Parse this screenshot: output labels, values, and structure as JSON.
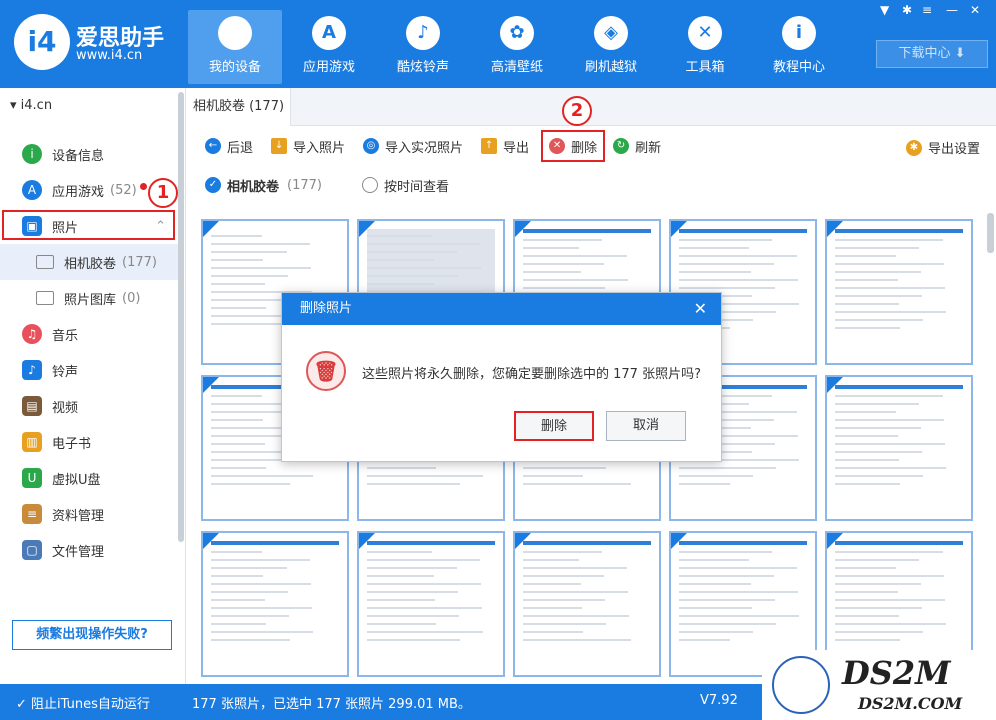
{
  "brand": {
    "logo": "i4",
    "name": "爱思助手",
    "url": "www.i4.cn"
  },
  "nav": [
    {
      "label": "我的设备",
      "icon": "apple-icon",
      "glyph": ""
    },
    {
      "label": "应用游戏",
      "icon": "app-store-icon",
      "glyph": "A"
    },
    {
      "label": "酷炫铃声",
      "icon": "bell-icon",
      "glyph": "♪"
    },
    {
      "label": "高清壁纸",
      "icon": "flower-icon",
      "glyph": "✿"
    },
    {
      "label": "刷机越狱",
      "icon": "dropbox-icon",
      "glyph": "◈"
    },
    {
      "label": "工具箱",
      "icon": "tools-icon",
      "glyph": "✕"
    },
    {
      "label": "教程中心",
      "icon": "info-icon",
      "glyph": "i"
    }
  ],
  "window": {
    "download_center": "下载中心 ⬇"
  },
  "sidebar": {
    "device": "i4.cn",
    "items": [
      {
        "label": "设备信息",
        "icon": "info-icon",
        "color": "#2aa84a",
        "glyph": "i"
      },
      {
        "label": "应用游戏",
        "count": "(52)",
        "icon": "app-icon",
        "color": "#1a7be0",
        "glyph": "A"
      },
      {
        "label": "照片",
        "icon": "photo-icon",
        "color": "#1a7be0",
        "glyph": "▣"
      },
      {
        "label": "相机胶卷",
        "count": "(177)",
        "icon": "folder-icon"
      },
      {
        "label": "照片图库",
        "count": "(0)",
        "icon": "folder-icon"
      },
      {
        "label": "音乐",
        "icon": "music-icon",
        "color": "#e8505b",
        "glyph": "♫"
      },
      {
        "label": "铃声",
        "icon": "bell-icon",
        "color": "#1a7be0",
        "glyph": "♪"
      },
      {
        "label": "视频",
        "icon": "video-icon",
        "color": "#7a5a3a",
        "glyph": "▤"
      },
      {
        "label": "电子书",
        "icon": "book-icon",
        "color": "#e8a020",
        "glyph": "▥"
      },
      {
        "label": "虚拟U盘",
        "icon": "usb-icon",
        "color": "#2aa84a",
        "glyph": "U"
      },
      {
        "label": "资料管理",
        "icon": "contacts-icon",
        "color": "#c98a3a",
        "glyph": "≡"
      },
      {
        "label": "文件管理",
        "icon": "file-icon",
        "color": "#4a7ab8",
        "glyph": "▢"
      }
    ],
    "footer": "频繁出现操作失败?"
  },
  "annotations": {
    "step1": "1",
    "step2": "2"
  },
  "content": {
    "tab": "相机胶卷 (177)",
    "toolbar": {
      "back": "后退",
      "import_photos": "导入照片",
      "import_live": "导入实况照片",
      "export": "导出",
      "delete": "删除",
      "refresh": "刷新",
      "export_settings": "导出设置"
    },
    "filter": {
      "album": "相机胶卷",
      "album_count": "(177)",
      "by_time": "按时间查看"
    }
  },
  "dialog": {
    "title": "删除照片",
    "message": "这些照片将永久删除，您确定要删除选中的 177 张照片吗?",
    "confirm": "删除",
    "cancel": "取消"
  },
  "status": {
    "itunes": "阻止iTunes自动运行",
    "summary": "177 张照片，已选中 177 张照片 299.01 MB。",
    "version": "V7.92"
  },
  "watermark": {
    "name": "DS2M",
    "url": "DS2M.COM"
  }
}
